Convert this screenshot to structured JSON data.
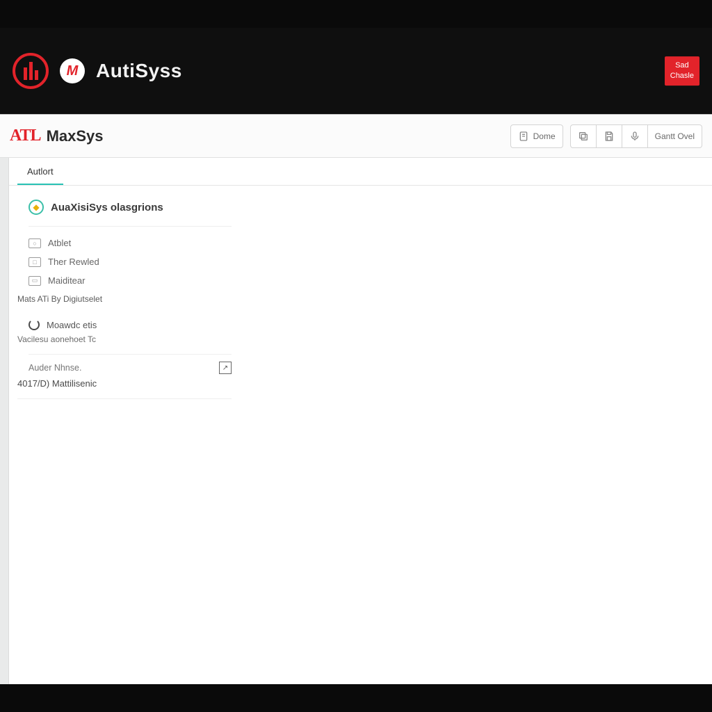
{
  "colors": {
    "brand_red": "#e2232a",
    "teal": "#27c2b5"
  },
  "topbar": {
    "title": "AutiSyss",
    "small_logo_glyph": "M",
    "button_line1": "Sad",
    "button_line2": "Chasle"
  },
  "subheader": {
    "atl_logo_text": "ATL",
    "title": "MaxSys",
    "buttons": {
      "dome": "Dome",
      "gantt": "Gantt Ovel"
    }
  },
  "tabs": [
    {
      "label": "Autlort",
      "active": true
    }
  ],
  "panel": {
    "title": "AuaXisiSys olasgrions",
    "nav": [
      {
        "icon_text": "○",
        "label": "Atblet"
      },
      {
        "icon_text": "□",
        "label": "Ther Rewled"
      },
      {
        "icon_text": "▭",
        "label": "Maiditear"
      }
    ],
    "group_label": "Mats ATi By Digiutselet",
    "section": {
      "title": "Moawdc etis",
      "sub_label": "Vacilesu aonehoet Tc"
    },
    "field": {
      "label": "Auder Nhnse.",
      "value": "4017/D) Mattilisenic"
    }
  }
}
